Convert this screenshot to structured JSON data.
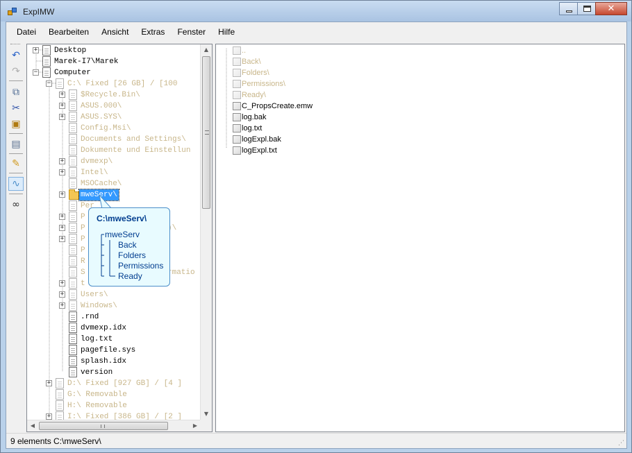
{
  "window": {
    "title": "ExpIMW"
  },
  "menu": [
    "Datei",
    "Bearbeiten",
    "Ansicht",
    "Extras",
    "Fenster",
    "Hilfe"
  ],
  "toolbar": {
    "icons": [
      "undo-icon",
      "redo-icon",
      "copy-icon",
      "cut-icon",
      "paste-icon",
      "properties-icon",
      "edit-icon",
      "view-icon",
      "search-binoculars-icon"
    ]
  },
  "tree": {
    "items": [
      {
        "label": "Desktop",
        "hidden": false,
        "expander": "+"
      },
      {
        "label": "Marek-I7\\Marek",
        "hidden": false,
        "expander": ""
      },
      {
        "label": "Computer",
        "hidden": false,
        "expander": "−"
      },
      {
        "label": "C:\\ Fixed  [26 GB] /  [100",
        "hidden": true,
        "expander": "−"
      },
      {
        "label": "$Recycle.Bin\\",
        "hidden": true,
        "expander": "+"
      },
      {
        "label": "ASUS.000\\",
        "hidden": true,
        "expander": "+"
      },
      {
        "label": "ASUS.SYS\\",
        "hidden": true,
        "expander": "+"
      },
      {
        "label": "Config.Msi\\",
        "hidden": true,
        "expander": ""
      },
      {
        "label": "Documents and Settings\\",
        "hidden": true,
        "expander": ""
      },
      {
        "label": "Dokumente und Einstellun",
        "hidden": true,
        "expander": ""
      },
      {
        "label": "dvmexp\\",
        "hidden": true,
        "expander": "+"
      },
      {
        "label": "Intel\\",
        "hidden": true,
        "expander": "+"
      },
      {
        "label": "MSOCache\\",
        "hidden": true,
        "expander": ""
      },
      {
        "label": "mweServ\\",
        "hidden": false,
        "expander": "+",
        "selected": true
      },
      {
        "label": "Per",
        "hidden": true,
        "expander": ""
      },
      {
        "label": "P",
        "hidden": true,
        "expander": "+"
      },
      {
        "label": "P",
        "hidden": true,
        "expander": "+",
        "suffix": ")\\"
      },
      {
        "label": "P",
        "hidden": true,
        "expander": "+"
      },
      {
        "label": "P",
        "hidden": true,
        "expander": ""
      },
      {
        "label": "R",
        "hidden": true,
        "expander": ""
      },
      {
        "label": "S",
        "hidden": true,
        "expander": "",
        "suffix": "rmatio"
      },
      {
        "label": "t",
        "hidden": true,
        "expander": "+"
      },
      {
        "label": "Users\\",
        "hidden": true,
        "expander": "+"
      },
      {
        "label": "Windows\\",
        "hidden": true,
        "expander": "+"
      },
      {
        "label": ".rnd",
        "hidden": false,
        "expander": ""
      },
      {
        "label": "dvmexp.idx",
        "hidden": false,
        "expander": ""
      },
      {
        "label": "log.txt",
        "hidden": false,
        "expander": ""
      },
      {
        "label": "pagefile.sys",
        "hidden": false,
        "expander": ""
      },
      {
        "label": "splash.idx",
        "hidden": false,
        "expander": ""
      },
      {
        "label": "version",
        "hidden": false,
        "expander": ""
      },
      {
        "label": "D:\\ Fixed  [927 GB] /  [4 ]",
        "hidden": true,
        "expander": "+"
      },
      {
        "label": "G:\\ Removable",
        "hidden": true,
        "expander": ""
      },
      {
        "label": "H:\\ Removable",
        "hidden": true,
        "expander": ""
      },
      {
        "label": "I:\\ Fixed  [386 GB] /  [2 ]",
        "hidden": true,
        "expander": "+"
      }
    ]
  },
  "list": {
    "items": [
      {
        "label": "..",
        "hidden": true
      },
      {
        "label": "Back\\",
        "hidden": true
      },
      {
        "label": "Folders\\",
        "hidden": true
      },
      {
        "label": "Permissions\\",
        "hidden": true
      },
      {
        "label": "Ready\\",
        "hidden": true
      },
      {
        "label": "C_PropsCreate.emw",
        "hidden": false
      },
      {
        "label": "log.bak",
        "hidden": false
      },
      {
        "label": "log.txt",
        "hidden": false
      },
      {
        "label": "logExpl.bak",
        "hidden": false
      },
      {
        "label": "logExpl.txt",
        "hidden": false
      }
    ]
  },
  "tooltip": {
    "title": "C:\\mweServ\\",
    "root": "mweServ",
    "children": [
      "Back",
      "Folders",
      "Permissions",
      "Ready"
    ]
  },
  "status": {
    "text": "9 elements C:\\mweServ\\"
  }
}
